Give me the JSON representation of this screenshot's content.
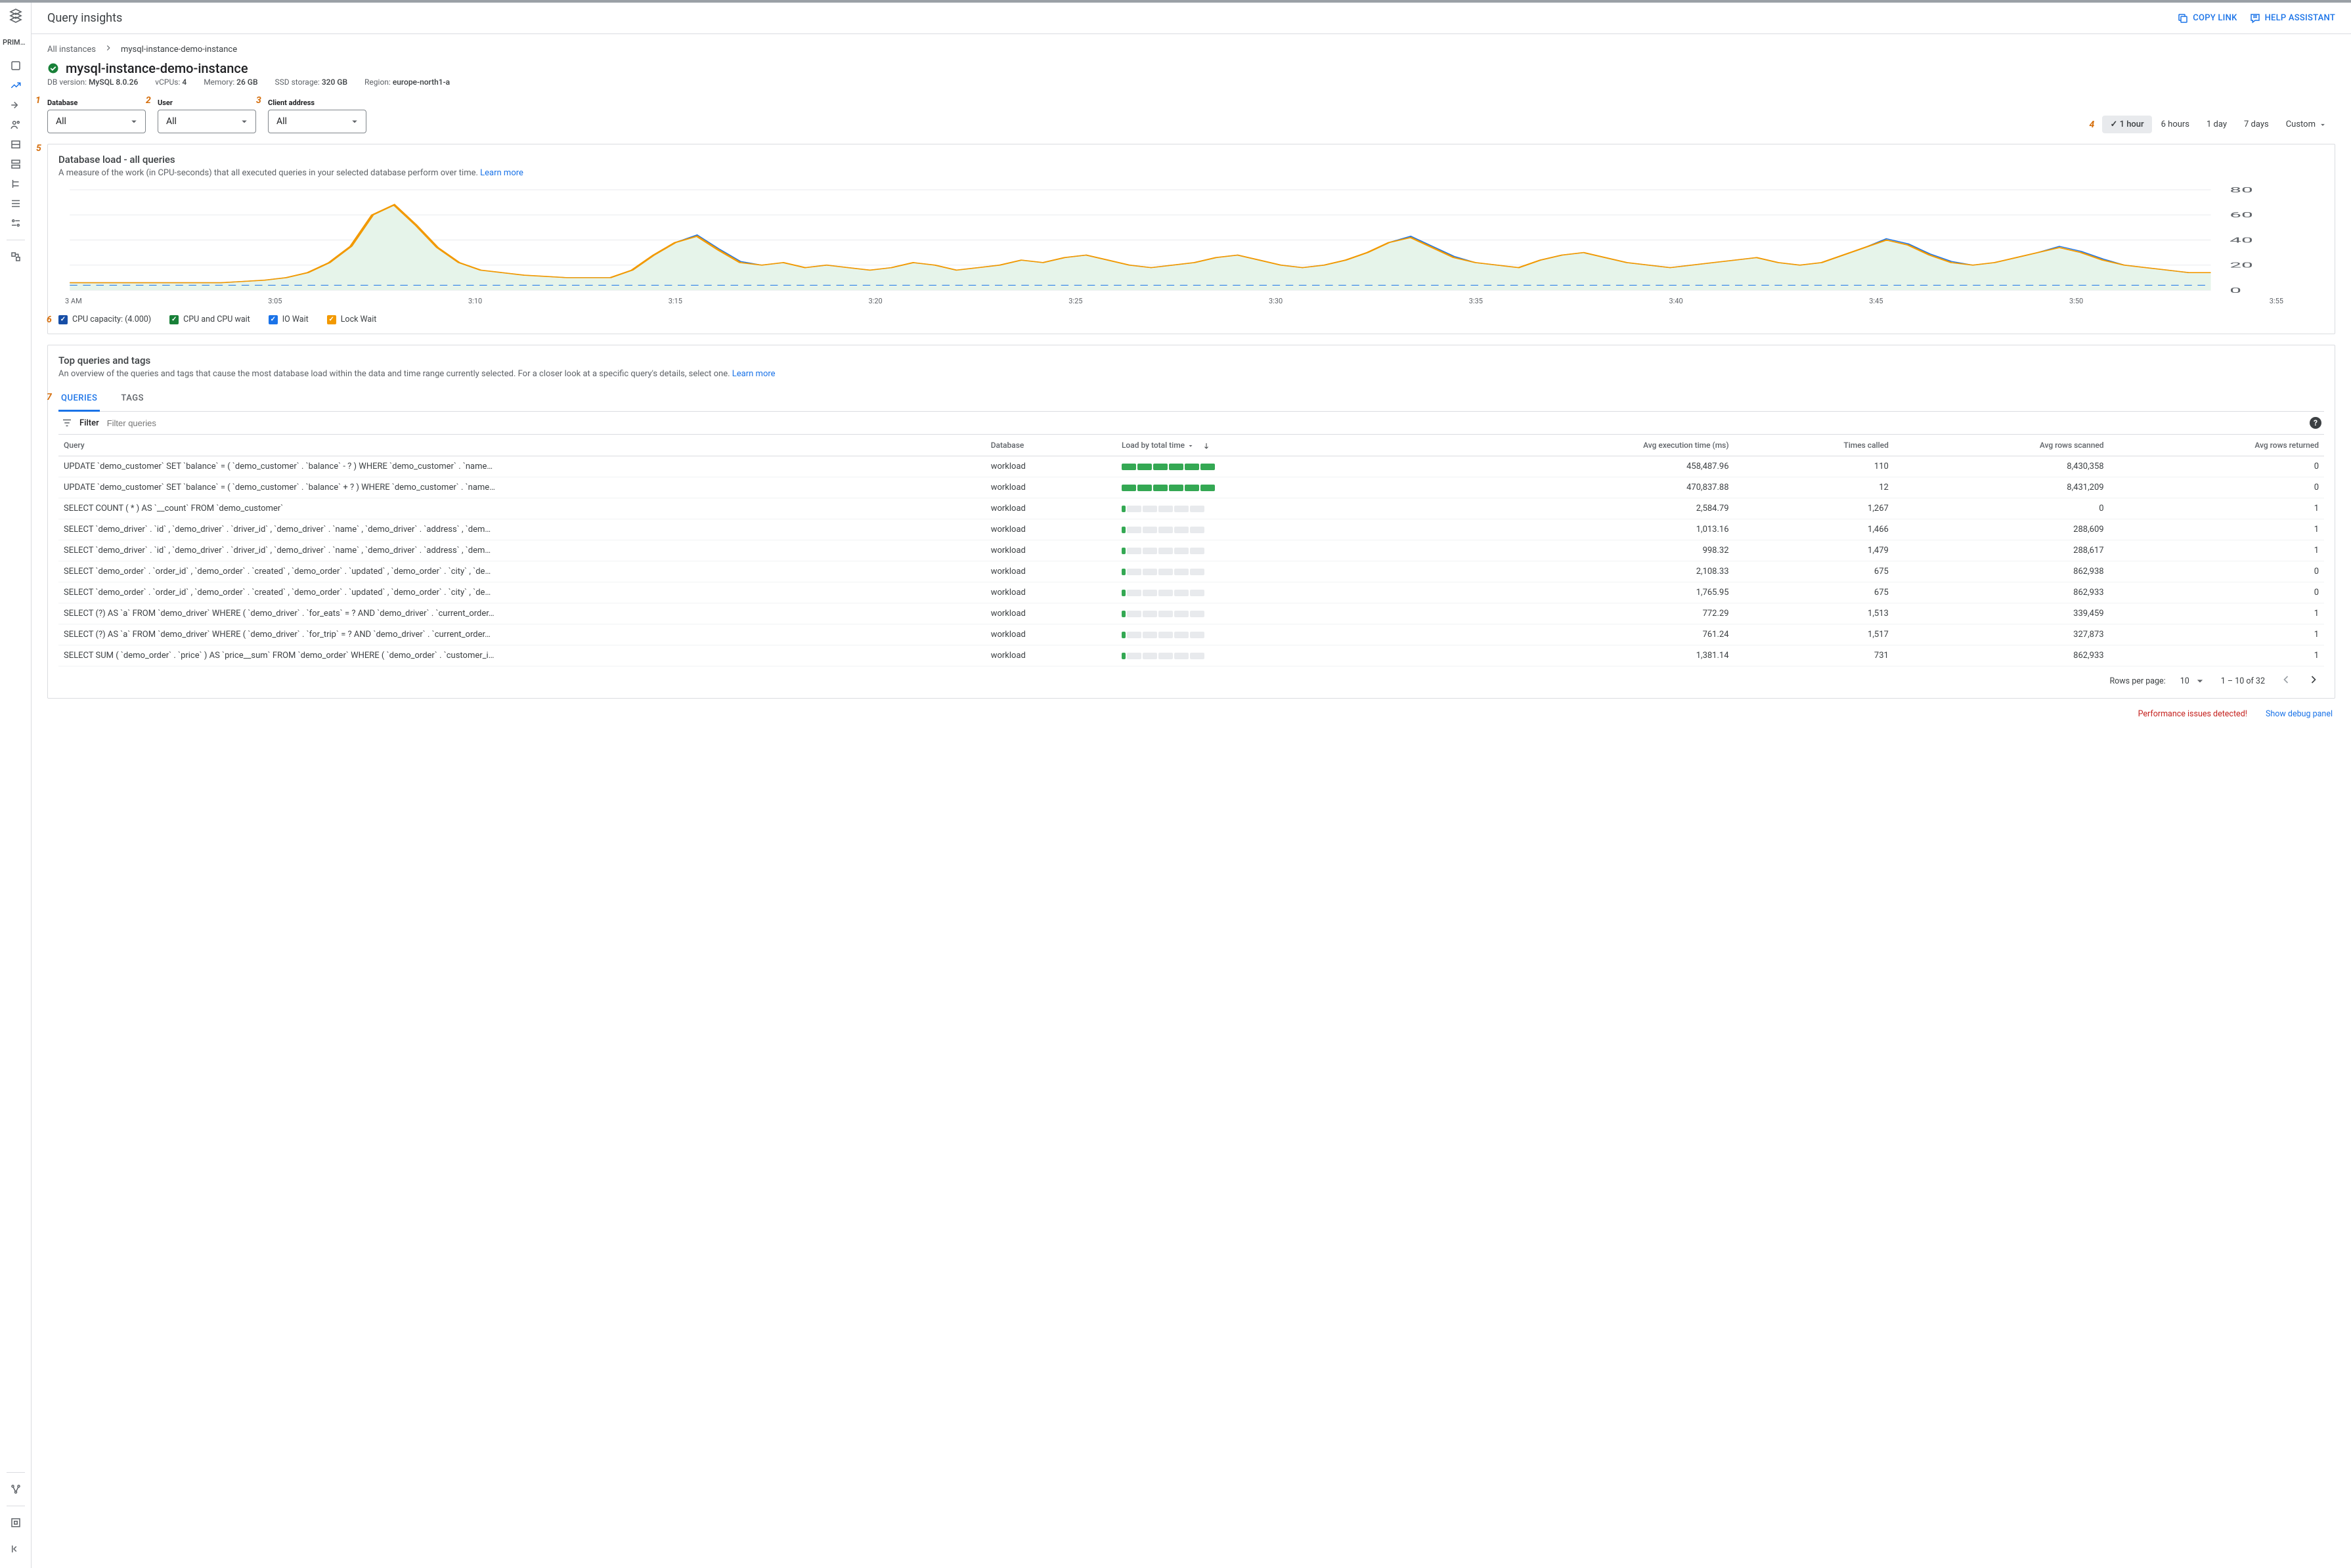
{
  "app_title": "Query insights",
  "actions": {
    "copy": "COPY LINK",
    "help": "HELP ASSISTANT"
  },
  "rail": {
    "product": "PRIMARY"
  },
  "breadcrumb": {
    "root": "All instances",
    "current": "mysql-instance-demo-instance"
  },
  "instance_title": "mysql-instance-demo-instance",
  "meta": {
    "db_label": "DB version:",
    "db_value": "MySQL 8.0.26",
    "cpu_label": "vCPUs:",
    "cpu_value": "4",
    "mem_label": "Memory:",
    "mem_value": "26 GB",
    "ssd_label": "SSD storage:",
    "ssd_value": "320 GB",
    "region_label": "Region:",
    "region_value": "europe-north1-a"
  },
  "annotations": {
    "a1": "1",
    "a2": "2",
    "a3": "3",
    "a4": "4",
    "a5": "5",
    "a6": "6",
    "a7": "7"
  },
  "filters": {
    "database": {
      "label": "Database",
      "value": "All"
    },
    "user": {
      "label": "User",
      "value": "All"
    },
    "client": {
      "label": "Client address",
      "value": "All"
    },
    "range": [
      "1 hour",
      "6 hours",
      "1 day",
      "7 days",
      "Custom"
    ],
    "range_selected": 0
  },
  "load_section": {
    "title": "Database load - all queries",
    "desc": "A measure of the work (in CPU-seconds) that all executed queries in your selected database perform over time.",
    "learn": "Learn more"
  },
  "chart_data": {
    "type": "area",
    "x": [
      "3 AM",
      "3:05",
      "3:10",
      "3:15",
      "3:20",
      "3:25",
      "3:30",
      "3:35",
      "3:40",
      "3:45",
      "3:50",
      "3:55"
    ],
    "series": [
      {
        "name": "CPU and CPU wait",
        "color": "#f29900",
        "values": [
          6,
          6,
          6,
          6,
          6,
          6,
          6,
          6,
          7,
          8,
          10,
          14,
          22,
          35,
          60,
          68,
          52,
          34,
          22,
          16,
          14,
          12,
          11,
          10,
          10,
          10,
          16,
          28,
          38,
          43,
          32,
          22,
          20,
          22,
          18,
          20,
          18,
          16,
          18,
          22,
          20,
          16,
          18,
          20,
          24,
          22,
          26,
          28,
          24,
          20,
          18,
          20,
          22,
          26,
          28,
          24,
          20,
          18,
          20,
          24,
          30,
          38,
          42,
          34,
          26,
          22,
          20,
          18,
          24,
          28,
          30,
          26,
          22,
          20,
          18,
          20,
          22,
          24,
          26,
          22,
          20,
          22,
          28,
          34,
          40,
          36,
          28,
          22,
          20,
          22,
          26,
          30,
          34,
          30,
          24,
          20,
          18,
          16,
          14,
          14
        ]
      },
      {
        "name": "IO Wait",
        "color": "#1a73e8",
        "values": [
          6,
          6,
          6,
          6,
          6,
          6,
          6,
          6,
          7,
          8,
          10,
          14,
          22,
          35,
          60,
          68,
          52,
          34,
          22,
          16,
          14,
          12,
          11,
          10,
          10,
          10,
          16,
          28,
          38,
          44,
          33,
          23,
          20,
          22,
          18,
          20,
          18,
          16,
          18,
          22,
          20,
          16,
          18,
          20,
          24,
          22,
          26,
          28,
          24,
          20,
          18,
          20,
          22,
          26,
          28,
          24,
          20,
          18,
          20,
          24,
          30,
          38,
          43,
          35,
          27,
          22,
          20,
          18,
          24,
          28,
          30,
          26,
          22,
          20,
          18,
          20,
          22,
          24,
          26,
          22,
          20,
          22,
          28,
          34,
          41,
          37,
          29,
          23,
          20,
          22,
          26,
          30,
          35,
          31,
          25,
          20,
          18,
          16,
          14,
          14
        ]
      }
    ],
    "capacity_line": 4,
    "ylim": [
      0,
      80
    ],
    "yticks": [
      0,
      20,
      40,
      60,
      80
    ]
  },
  "legend": {
    "cap": "CPU capacity: (4.000)",
    "cpu": "CPU and CPU wait",
    "io": "IO Wait",
    "lock": "Lock Wait"
  },
  "top_section": {
    "title": "Top queries and tags",
    "desc": "An overview of the queries and tags that cause the most database load within the data and time range currently selected. For a closer look at a specific query's details, select one.",
    "learn": "Learn more",
    "tabs": [
      "QUERIES",
      "TAGS"
    ],
    "filter_label": "Filter",
    "filter_placeholder": "Filter queries"
  },
  "columns": {
    "query": "Query",
    "database": "Database",
    "load": "Load by total time",
    "exec": "Avg execution time (ms)",
    "times": "Times called",
    "scanned": "Avg rows scanned",
    "returned": "Avg rows returned"
  },
  "rows": [
    {
      "q": "UPDATE `demo_customer` SET `balance` = ( `demo_customer` . `balance` - ? ) WHERE `demo_customer` . `name…",
      "db": "workload",
      "load": 100,
      "exec": "458,487.96",
      "times": "110",
      "scanned": "8,430,358",
      "ret": "0"
    },
    {
      "q": "UPDATE `demo_customer` SET `balance` = ( `demo_customer` . `balance` + ? ) WHERE `demo_customer` . `name…",
      "db": "workload",
      "load": 98,
      "exec": "470,837.88",
      "times": "12",
      "scanned": "8,431,209",
      "ret": "0"
    },
    {
      "q": "SELECT COUNT ( * ) AS `__count` FROM `demo_customer`",
      "db": "workload",
      "load": 6,
      "exec": "2,584.79",
      "times": "1,267",
      "scanned": "0",
      "ret": "1"
    },
    {
      "q": "SELECT `demo_driver` . `id` , `demo_driver` . `driver_id` , `demo_driver` . `name` , `demo_driver` . `address` , `dem…",
      "db": "workload",
      "load": 4,
      "exec": "1,013.16",
      "times": "1,466",
      "scanned": "288,609",
      "ret": "1"
    },
    {
      "q": "SELECT `demo_driver` . `id` , `demo_driver` . `driver_id` , `demo_driver` . `name` , `demo_driver` . `address` , `dem…",
      "db": "workload",
      "load": 4,
      "exec": "998.32",
      "times": "1,479",
      "scanned": "288,617",
      "ret": "1"
    },
    {
      "q": "SELECT `demo_order` . `order_id` , `demo_order` . `created` , `demo_order` . `updated` , `demo_order` . `city` , `de…",
      "db": "workload",
      "load": 4,
      "exec": "2,108.33",
      "times": "675",
      "scanned": "862,938",
      "ret": "0"
    },
    {
      "q": "SELECT `demo_order` . `order_id` , `demo_order` . `created` , `demo_order` . `updated` , `demo_order` . `city` , `de…",
      "db": "workload",
      "load": 4,
      "exec": "1,765.95",
      "times": "675",
      "scanned": "862,933",
      "ret": "0"
    },
    {
      "q": "SELECT (?) AS `a` FROM `demo_driver` WHERE ( `demo_driver` . `for_eats` = ? AND `demo_driver` . `current_order…",
      "db": "workload",
      "load": 3,
      "exec": "772.29",
      "times": "1,513",
      "scanned": "339,459",
      "ret": "1"
    },
    {
      "q": "SELECT (?) AS `a` FROM `demo_driver` WHERE ( `demo_driver` . `for_trip` = ? AND `demo_driver` . `current_order…",
      "db": "workload",
      "load": 3,
      "exec": "761.24",
      "times": "1,517",
      "scanned": "327,873",
      "ret": "1"
    },
    {
      "q": "SELECT SUM ( `demo_order` . `price` ) AS `price__sum` FROM `demo_order` WHERE ( `demo_order` . `customer_i…",
      "db": "workload",
      "load": 3,
      "exec": "1,381.14",
      "times": "731",
      "scanned": "862,933",
      "ret": "1"
    }
  ],
  "pagination": {
    "label": "Rows per page:",
    "per": "10",
    "range": "1 – 10 of 32"
  },
  "footer": {
    "warn": "Performance issues detected!",
    "debug": "Show debug panel"
  }
}
